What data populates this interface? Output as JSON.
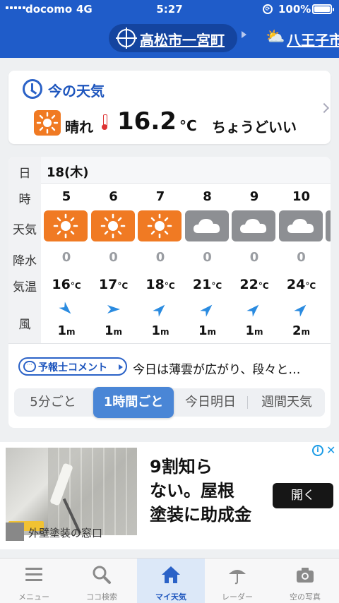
{
  "status_bar": {
    "carrier": "docomo",
    "network": "4G",
    "time": "5:27",
    "battery": "100%"
  },
  "header": {
    "current_location": "高松市一宮町",
    "next_location": "八王子市"
  },
  "now": {
    "title": "今の天気",
    "condition": "晴れ",
    "temperature": "16.2",
    "unit": "°C",
    "feeling": "ちょうどいい"
  },
  "hourly": {
    "row_labels": {
      "date": "日",
      "time": "時",
      "weather": "天気",
      "precip": "降水",
      "temp": "気温",
      "wind": "風"
    },
    "date": "18(木)",
    "hours": [
      {
        "hour": "5",
        "weather": "sunny",
        "precip": "0",
        "temp": "16",
        "wind_dir": "NW",
        "wind_speed": "1"
      },
      {
        "hour": "6",
        "weather": "sunny",
        "precip": "0",
        "temp": "17",
        "wind_dir": "W",
        "wind_speed": "1"
      },
      {
        "hour": "7",
        "weather": "sunny",
        "precip": "0",
        "temp": "18",
        "wind_dir": "SW",
        "wind_speed": "1"
      },
      {
        "hour": "8",
        "weather": "cloudy",
        "precip": "0",
        "temp": "21",
        "wind_dir": "SW",
        "wind_speed": "1"
      },
      {
        "hour": "9",
        "weather": "cloudy",
        "precip": "0",
        "temp": "22",
        "wind_dir": "SW",
        "wind_speed": "1"
      },
      {
        "hour": "10",
        "weather": "cloudy",
        "precip": "0",
        "temp": "24",
        "wind_dir": "SW",
        "wind_speed": "2"
      }
    ],
    "temp_unit": "°C",
    "speed_unit": "m"
  },
  "comment": {
    "label": "予報士コメント",
    "text": "今日は薄雲が広がり、段々と…"
  },
  "tabs": [
    "5分ごと",
    "1時間ごと",
    "今日明日",
    "週間天気"
  ],
  "active_tab": "1時間ごと",
  "ad": {
    "headline_lines": [
      "9割知ら",
      "ない。屋根",
      "塗装に助成金"
    ],
    "cta": "開く",
    "source": "外壁塗装の窓口",
    "info": "i",
    "close": "✕"
  },
  "nav": [
    {
      "label": "メニュー",
      "icon": "menu-icon"
    },
    {
      "label": "ココ検索",
      "icon": "search-icon"
    },
    {
      "label": "マイ天気",
      "icon": "home-icon"
    },
    {
      "label": "レーダー",
      "icon": "radar-icon"
    },
    {
      "label": "空の写真",
      "icon": "camera-icon"
    }
  ],
  "colors": {
    "header": "#1f5cc9",
    "sunny": "#f07a23",
    "cloudy": "#8d8f93",
    "accent": "#4a86d6",
    "wind": "#2a8be0"
  }
}
